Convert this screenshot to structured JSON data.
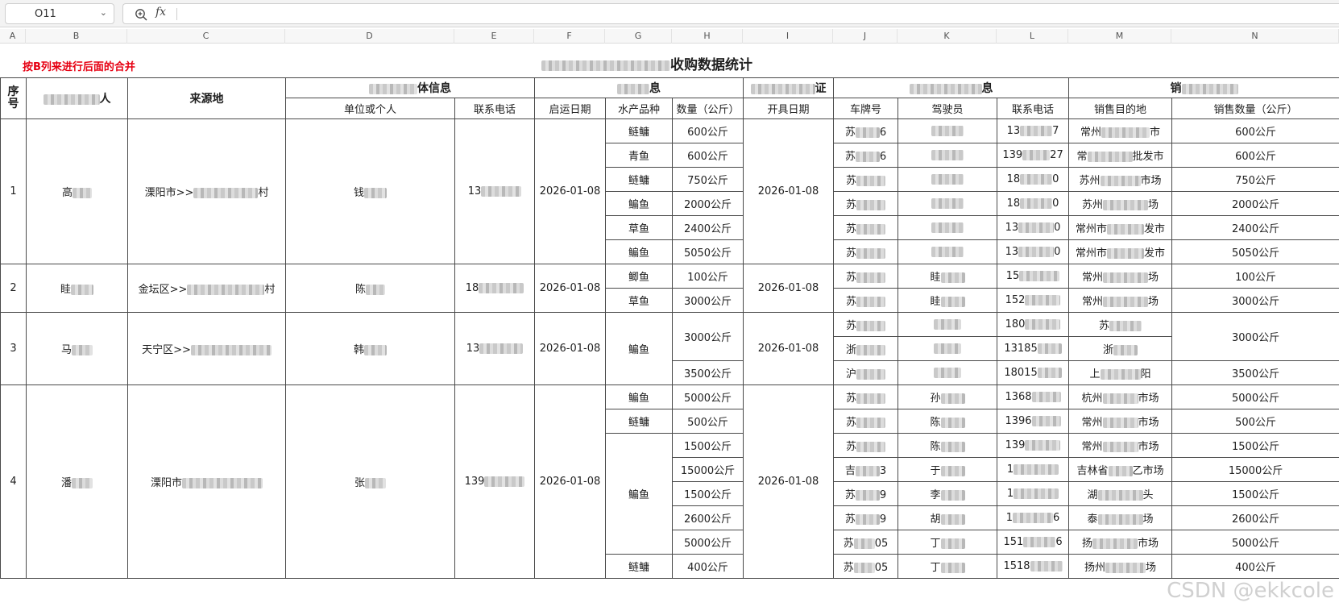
{
  "formula_bar": {
    "cell_ref": "O11",
    "fx_label": "fx",
    "formula": ""
  },
  "columns": [
    "A",
    "B",
    "C",
    "D",
    "E",
    "F",
    "G",
    "H",
    "I",
    "J",
    "K",
    "L",
    "M",
    "N"
  ],
  "sheet": {
    "note": "按B列来进行后面的合并",
    "title": "收购数据统计"
  },
  "header": {
    "seq": "序号",
    "agent": "人",
    "origin": "来源地",
    "body_info": "体信息",
    "unit": "单位或个人",
    "phone": "联系电话",
    "goods_info": "息",
    "depart_date": "启运日期",
    "species": "水产品种",
    "quantity": "数量（公斤）",
    "cert": "证",
    "issue_date": "开具日期",
    "transport_info": "息",
    "plate": "车牌号",
    "driver": "驾驶员",
    "driver_phone": "联系电话",
    "sales_info": "销",
    "dest": "销售目的地",
    "sale_qty": "销售数量（公斤）"
  },
  "groups": [
    {
      "seq": "1",
      "agent": "高",
      "origin": "溧阳市>>",
      "origin_tail": "村",
      "unit": "钱",
      "phone": "13",
      "depart_date": "2026-01-08",
      "issue_date": "2026-01-08",
      "rows": [
        {
          "species": "鲢鳙",
          "qty": "600公斤",
          "plate": "苏",
          "plate_tail": "6",
          "phone": "13",
          "phone_tail": "7",
          "dest": "常州",
          "dest_tail": "市",
          "sale": "600公斤"
        },
        {
          "species": "青鱼",
          "qty": "600公斤",
          "plate": "苏",
          "plate_tail": "6",
          "phone": "139",
          "phone_tail": "27",
          "dest": "常",
          "dest_tail": "批发市",
          "sale": "600公斤"
        },
        {
          "species": "鲢鳙",
          "qty": "750公斤",
          "plate": "苏",
          "plate_tail": "",
          "phone": "18",
          "phone_tail": "0",
          "dest": "苏州",
          "dest_tail": "市场",
          "sale": "750公斤"
        },
        {
          "species": "鳊鱼",
          "qty": "2000公斤",
          "plate": "苏",
          "plate_tail": "",
          "phone": "18",
          "phone_tail": "0",
          "dest": "苏州",
          "dest_tail": "场",
          "sale": "2000公斤"
        },
        {
          "species": "草鱼",
          "qty": "2400公斤",
          "plate": "苏",
          "plate_tail": "",
          "phone": "13",
          "phone_tail": "0",
          "dest": "常州市",
          "dest_tail": "发市",
          "sale": "2400公斤"
        },
        {
          "species": "鳊鱼",
          "qty": "5050公斤",
          "plate": "苏",
          "plate_tail": "",
          "phone": "13",
          "phone_tail": "0",
          "dest": "常州市",
          "dest_tail": "发市",
          "sale": "5050公斤"
        }
      ]
    },
    {
      "seq": "2",
      "agent": "眭",
      "origin": "金坛区>>",
      "origin_tail": "村",
      "unit": "陈",
      "phone": "18",
      "depart_date": "2026-01-08",
      "issue_date": "2026-01-08",
      "rows": [
        {
          "species": "鲫鱼",
          "qty": "100公斤",
          "plate": "苏",
          "plate_tail": "",
          "driver": "眭",
          "phone": "15",
          "phone_tail": "",
          "dest": "常州",
          "dest_tail": "场",
          "sale": "100公斤"
        },
        {
          "species": "草鱼",
          "qty": "3000公斤",
          "plate": "苏",
          "plate_tail": "",
          "driver": "眭",
          "phone": "152",
          "phone_tail": "",
          "dest": "常州",
          "dest_tail": "场",
          "sale": "3000公斤"
        }
      ]
    },
    {
      "seq": "3",
      "agent": "马",
      "origin": "天宁区>>",
      "origin_tail": "",
      "unit": "韩",
      "phone": "13",
      "depart_date": "2026-01-08",
      "issue_date": "2026-01-08",
      "species": "鳊鱼",
      "qty_a": "3000公斤",
      "qty_b": "3500公斤",
      "sale_a": "3000公斤",
      "sale_b": "3500公斤",
      "trucks": [
        {
          "plate": "苏",
          "driver": "",
          "phone": "180",
          "phone_tail": "",
          "dest": "苏"
        },
        {
          "plate": "浙",
          "driver": "",
          "phone": "13185",
          "phone_tail": "",
          "dest": "浙"
        },
        {
          "plate": "沪",
          "driver": "",
          "phone": "18015",
          "phone_tail": "",
          "dest": "上",
          "dest_tail": "阳"
        }
      ]
    },
    {
      "seq": "4",
      "agent": "潘",
      "origin": "溧阳市",
      "origin_tail": "",
      "unit": "张",
      "phone": "139",
      "depart_date": "2026-01-08",
      "issue_date": "2026-01-08",
      "species_mid": "鳊鱼",
      "rows": [
        {
          "species": "鳊鱼",
          "qty": "5000公斤",
          "plate": "苏",
          "plate_tail": "",
          "driver": "孙",
          "phone": "1368",
          "phone_tail": "",
          "dest": "杭州",
          "dest_tail": "市场",
          "sale": "5000公斤"
        },
        {
          "species": "鲢鳙",
          "qty": "500公斤",
          "plate": "苏",
          "plate_tail": "",
          "driver": "陈",
          "phone": "1396",
          "phone_tail": "",
          "dest": "常州",
          "dest_tail": "市场",
          "sale": "500公斤"
        },
        {
          "qty": "1500公斤",
          "plate": "苏",
          "plate_tail": "",
          "driver": "陈",
          "phone": "139",
          "phone_tail": "",
          "dest": "常州",
          "dest_tail": "市场",
          "sale": "1500公斤"
        },
        {
          "qty": "15000公斤",
          "plate": "吉",
          "plate_tail": "3",
          "driver": "于",
          "phone": "1",
          "phone_tail": "",
          "dest": "吉林省",
          "dest_tail": "乙市场",
          "sale": "15000公斤"
        },
        {
          "qty": "1500公斤",
          "plate": "苏",
          "plate_tail": "9",
          "driver": "李",
          "phone": "1",
          "phone_tail": "",
          "dest": "湖",
          "dest_tail": "头",
          "sale": "1500公斤"
        },
        {
          "qty": "2600公斤",
          "plate": "苏",
          "plate_tail": "9",
          "driver": "胡",
          "phone": "1",
          "phone_tail": "6",
          "dest": "泰",
          "dest_tail": "场",
          "sale": "2600公斤"
        },
        {
          "qty": "5000公斤",
          "plate": "苏",
          "plate_tail": "05",
          "driver": "丁",
          "phone": "151",
          "phone_tail": "6",
          "dest": "扬",
          "dest_tail": "市场",
          "sale": "5000公斤"
        },
        {
          "species": "鲢鳙",
          "qty": "400公斤",
          "plate": "苏",
          "plate_tail": "05",
          "driver": "丁",
          "phone": "1518",
          "phone_tail": "",
          "dest": "扬州",
          "dest_tail": "场",
          "sale": "400公斤"
        }
      ]
    }
  ],
  "watermark": "CSDN @ekkcole"
}
